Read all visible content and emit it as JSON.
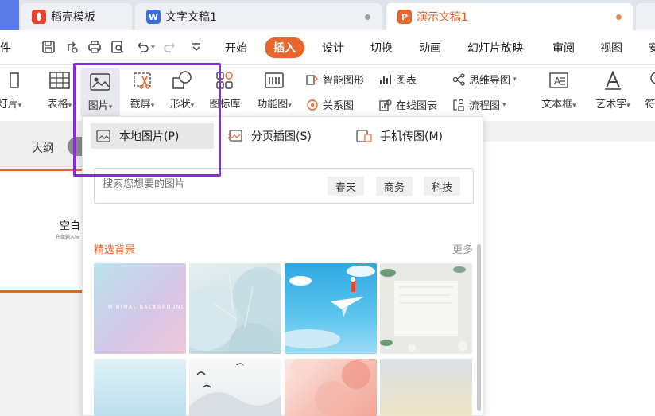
{
  "tabs": {
    "t1": {
      "label": "稻壳模板",
      "icon_color": "#e8462c"
    },
    "t2": {
      "label": "文字文稿1",
      "icon_color": "#3a6de0"
    },
    "t3": {
      "label": "演示文稿1",
      "icon_color": "#e8662c"
    }
  },
  "menu": {
    "left_partial": "件",
    "items": [
      "开始",
      "插入",
      "设计",
      "切换",
      "动画",
      "幻灯片放映",
      "审阅",
      "视图",
      "安"
    ]
  },
  "ribbon": {
    "left_partial": "灯片",
    "table": "表格",
    "picture": "图片",
    "screenshot": "截屏",
    "shape": "形状",
    "icon_library": "图标库",
    "function_chart": "功能图",
    "smart_graphic": "智能图形",
    "chart": "图表",
    "mind_map": "思维导图",
    "relation_chart": "关系图",
    "online_chart": "在线图表",
    "flow_chart": "流程图",
    "text_box": "文本框",
    "art_text": "艺术字",
    "right_partial": "符"
  },
  "sidebar": {
    "outline_label": "大纲"
  },
  "slide": {
    "title": "空白",
    "subtitle": "在此输入标"
  },
  "picture_panel": {
    "options": [
      "本地图片(P)",
      "分页插图(S)",
      "手机传图(M)"
    ],
    "search_placeholder": "搜索您想要的图片",
    "chips": [
      "春天",
      "商务",
      "科技"
    ],
    "section_title": "精选背景",
    "more": "更多",
    "thumb1_caption": "MINIMAL BACKGROUND"
  },
  "colors": {
    "accent": "#e8662c",
    "highlight": "#8a2be2"
  }
}
